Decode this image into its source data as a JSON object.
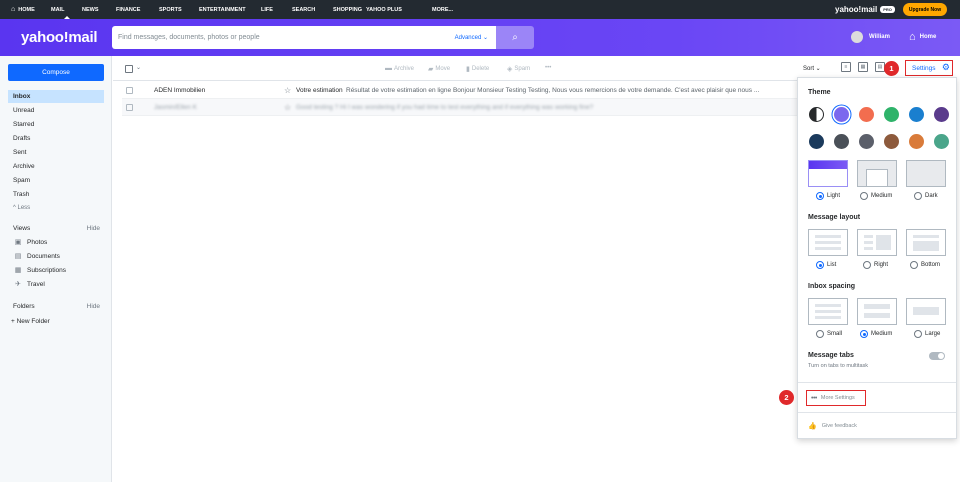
{
  "topnav": {
    "items": [
      "HOME",
      "MAIL",
      "NEWS",
      "FINANCE",
      "SPORTS",
      "ENTERTAINMENT",
      "LIFE",
      "SEARCH",
      "SHOPPING",
      "YAHOO PLUS",
      "MORE..."
    ],
    "brand": "yahoo!mail",
    "brand_pill": "PRO",
    "upgrade_label": "Upgrade Now"
  },
  "header": {
    "logo": "yahoo!mail",
    "search_placeholder": "Find messages, documents, photos or people",
    "advanced_label": "Advanced",
    "user_name": "William",
    "home_label": "Home"
  },
  "sidebar": {
    "compose_label": "Compose",
    "folders": [
      "Inbox",
      "Unread",
      "Starred",
      "Drafts",
      "Sent",
      "Archive",
      "Spam",
      "Trash"
    ],
    "less_label": "^ Less",
    "views_label": "Views",
    "views_hide": "Hide",
    "views": [
      "Photos",
      "Documents",
      "Subscriptions",
      "Travel"
    ],
    "folders_label": "Folders",
    "folders_hide": "Hide",
    "new_folder_label": "+ New Folder"
  },
  "toolbar": {
    "archive": "Archive",
    "move": "Move",
    "delete": "Delete",
    "spam": "Spam",
    "more": "•••",
    "sort": "Sort ⌄"
  },
  "messages": [
    {
      "sender": "ADEN Immobilien",
      "subject": "Votre estimation",
      "snippet": "Résultat de votre estimation en ligne Bonjour Monsieur Testing Testing, Nous vous remercions de votre demande. C'est avec plaisir que nous ..."
    },
    {
      "sender": "Jasmin/Ellen K",
      "subject": "Good testing ?",
      "snippet": "Hi I was wondering if you had time to test everything and if everything was working fine?"
    }
  ],
  "settings": {
    "link_label": "Settings",
    "theme_label": "Theme",
    "theme_colors_row1": [
      "#26282a",
      "#7b68ee",
      "#f26d4f",
      "#2fb36a",
      "#1a7fcf",
      "#5a3b8c"
    ],
    "theme_colors_row2": [
      "#1b3a5c",
      "#4a5058",
      "#5b5f6a",
      "#8d5a3c",
      "#d97b3a",
      "#4aa58a"
    ],
    "theme_options": [
      "Light",
      "Medium",
      "Dark"
    ],
    "layout_label": "Message layout",
    "layout_options": [
      "List",
      "Right",
      "Bottom"
    ],
    "spacing_label": "Inbox spacing",
    "spacing_options": [
      "Small",
      "Medium",
      "Large"
    ],
    "tabs_label": "Message tabs",
    "tabs_desc": "Turn on tabs to multitask",
    "more_settings_label": "More Settings",
    "feedback_label": "Give feedback"
  },
  "badges": [
    "1",
    "2"
  ]
}
